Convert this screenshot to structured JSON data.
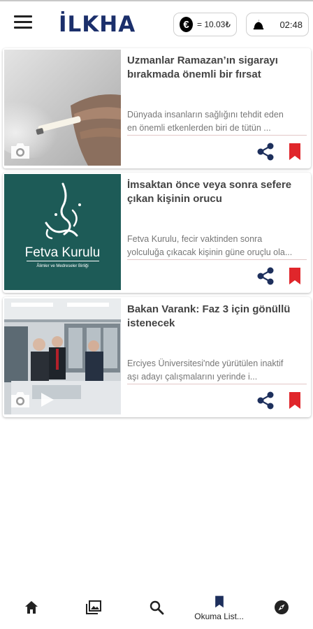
{
  "header": {
    "menu_icon": "hamburger-menu-icon",
    "logo_main": "İLKHA",
    "currency": {
      "symbol": "€",
      "value": "= 10.03₺"
    },
    "prayer": {
      "icon": "mosque-icon",
      "time": "02:48"
    }
  },
  "articles": [
    {
      "title": "Uzmanlar Ramazan’ın sigarayı bırakmada önemli bir fırsat",
      "summary_line1": "Dünyada insanların sağlığını tehdit eden",
      "summary_line2": "en önemli etkenlerden biri de tütün ...",
      "media_icons": [
        "camera-icon"
      ]
    },
    {
      "title": "İmsaktan önce veya sonra sefere çıkan kişinin orucu",
      "summary_line1": "Fetva Kurulu, fecir vaktinden sonra",
      "summary_line2": "yolculuğa çıkacak kişinin güne oruçlu ola...",
      "image_text_main": "Fetva Kurulu",
      "image_text_sub": "Âlimler ve Medreseler Birliği",
      "media_icons": []
    },
    {
      "title": "Bakan Varank: Faz 3 için gönüllü istenecek",
      "summary_line1": "Erciyes Üniversitesi'nde yürütülen inaktif",
      "summary_line2": "aşı adayı çalışmalarını yerinde i...",
      "media_icons": [
        "camera-icon",
        "play-icon"
      ]
    }
  ],
  "actions": {
    "share_icon": "share-icon",
    "bookmark_icon": "bookmark-icon"
  },
  "colors": {
    "brand_navy": "#1b2f6b",
    "accent_red": "#e0262b",
    "share_navy": "#1d2f5c"
  },
  "bottom_nav": [
    {
      "icon": "home-icon",
      "label": ""
    },
    {
      "icon": "gallery-icon",
      "label": ""
    },
    {
      "icon": "search-icon",
      "label": ""
    },
    {
      "icon": "bookmark-icon",
      "label": "Okuma List..."
    },
    {
      "icon": "compass-icon",
      "label": ""
    }
  ]
}
